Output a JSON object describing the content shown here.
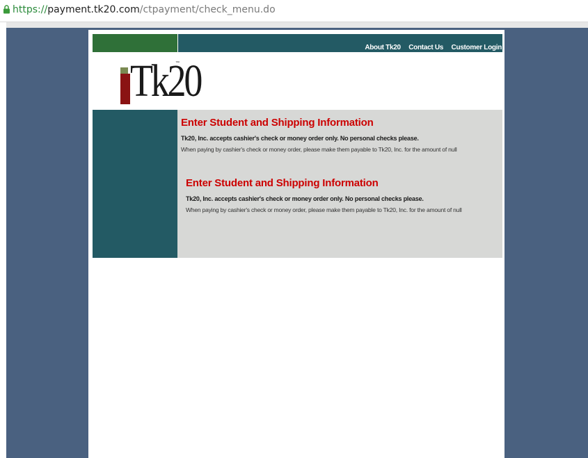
{
  "browser": {
    "url_scheme": "https://",
    "url_host": "payment.tk20.com",
    "url_path": "/ctpayment/check_menu.do"
  },
  "colors": {
    "viewport_bg": "#4a6180",
    "band_green": "#2f7038",
    "band_teal": "#235a64",
    "content_bg": "#d7d8d6",
    "heading_red": "#cc0000"
  },
  "header": {
    "logo_text": "Tk20",
    "nav": [
      "About Tk20",
      "Contact Us",
      "Customer Login"
    ]
  },
  "sections": [
    {
      "title": "Enter Student and Shipping Information",
      "notice": "Tk20, Inc. accepts cashier's check or money order only. No personal checks please.",
      "payable": "When paying by cashier's check or money order, please make them payable to Tk20, Inc. for the amount of null"
    },
    {
      "title": "Enter Student and Shipping Information",
      "notice": "Tk20, Inc. accepts cashier's check or money order only. No personal checks please.",
      "payable": "When paying by cashier's check or money order, please make them payable to Tk20, Inc. for the amount of null"
    }
  ]
}
